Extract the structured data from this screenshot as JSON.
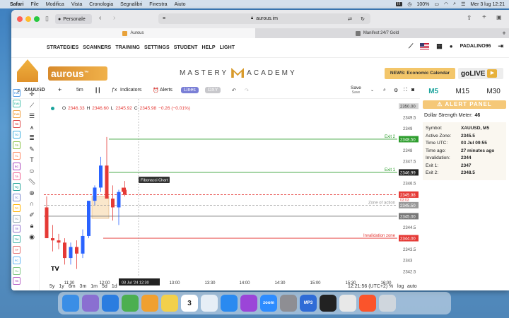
{
  "menubar": {
    "app": "Safari",
    "items": [
      "File",
      "Modifica",
      "Vista",
      "Cronologia",
      "Segnalibri",
      "Finestra",
      "Aiuto"
    ],
    "battery": "100%",
    "datetime": "Mer 3 lug 12:21",
    "lang": "IT"
  },
  "browser": {
    "profile": "Personale",
    "url": "aurous.im",
    "tabs": [
      {
        "label": "Aurous"
      },
      {
        "label": "Manifest 24/7 Gold"
      }
    ]
  },
  "site": {
    "nav": [
      "STRATEGIES",
      "SCANNERS",
      "TRAINING",
      "SETTINGS",
      "STUDENT",
      "HELP",
      "LIGHT"
    ],
    "user": "PADALINO96",
    "brand": "aurous",
    "brand_tm": "™",
    "academy_left": "MASTERY",
    "academy_right": "ACADEMY",
    "news_btn": "NEWS: Economic Calendar",
    "golive": "goLIVE"
  },
  "toolbar": {
    "symbol": "XAUUSD",
    "interval": "5m",
    "indicators": "Indicators",
    "alerts": "Alerts",
    "lines": "Lines",
    "dxy": "DXY",
    "save": "Save",
    "save_sub": "Save"
  },
  "ohlc": {
    "o_label": "O",
    "o": "2346.33",
    "h_label": "H",
    "h": "2346.60",
    "l_label": "L",
    "l": "2345.92",
    "c_label": "C",
    "c": "2345.98",
    "chg": "−0.26 (−0.01%)"
  },
  "chart_data": {
    "type": "candlestick",
    "symbol": "XAUUSD",
    "interval": "5m",
    "ylim": [
      2342.3,
      2350.2
    ],
    "y_ticks": [
      2350.0,
      2349.5,
      2349.0,
      2348.5,
      2348.0,
      2347.5,
      2347.0,
      2346.5,
      2346.0,
      2345.5,
      2345.0,
      2344.5,
      2344.0,
      2343.5,
      2343.0,
      2342.5
    ],
    "x_ticks": [
      "11:30",
      "12:00",
      "13:00",
      "13:30",
      "14:00",
      "14:30",
      "15:00",
      "15:30",
      "16:00"
    ],
    "crosshair_label": "03 Jul '24   12:30",
    "candles": [
      {
        "o": 2345.4,
        "h": 2345.9,
        "l": 2344.3,
        "c": 2344.0
      },
      {
        "o": 2344.0,
        "h": 2344.6,
        "l": 2343.4,
        "c": 2343.9
      },
      {
        "o": 2343.9,
        "h": 2344.2,
        "l": 2343.5,
        "c": 2343.8
      },
      {
        "o": 2343.8,
        "h": 2344.0,
        "l": 2342.8,
        "c": 2343.1
      },
      {
        "o": 2343.1,
        "h": 2343.8,
        "l": 2342.8,
        "c": 2343.6
      },
      {
        "o": 2343.6,
        "h": 2343.9,
        "l": 2342.6,
        "c": 2343.3
      },
      {
        "o": 2343.3,
        "h": 2344.4,
        "l": 2343.1,
        "c": 2344.1
      },
      {
        "o": 2344.1,
        "h": 2345.7,
        "l": 2344.0,
        "c": 2345.7
      },
      {
        "o": 2345.7,
        "h": 2346.4,
        "l": 2345.5,
        "c": 2346.3
      },
      {
        "o": 2346.3,
        "h": 2347.7,
        "l": 2346.1,
        "c": 2347.3
      },
      {
        "o": 2347.3,
        "h": 2348.6,
        "l": 2345.8,
        "c": 2345.8
      },
      {
        "o": 2345.8,
        "h": 2346.4,
        "l": 2344.8,
        "c": 2345.4
      },
      {
        "o": 2345.4,
        "h": 2346.2,
        "l": 2344.6,
        "c": 2346.1
      },
      {
        "o": 2346.2,
        "h": 2346.6,
        "l": 2345.9,
        "c": 2345.98
      }
    ],
    "levels": [
      {
        "name": "Exit 2",
        "value": 2348.5,
        "label": "2348.50",
        "color": "#2e9e2e"
      },
      {
        "name": "Exit 1",
        "value": 2346.99,
        "label": "2346.99",
        "color": "#2e9e2e"
      },
      {
        "name": "",
        "value": 2345.98,
        "label": "2345.98",
        "sub": "03:03",
        "color": "#e53935"
      },
      {
        "name": "Zone of action",
        "value": 2345.5,
        "label": "2345.50",
        "color": "#999999"
      },
      {
        "name": "",
        "value": 2345.0,
        "label": "2345.00",
        "color": "#777777"
      },
      {
        "name": "Invalidation zone",
        "value": 2344.0,
        "label": "2344.00",
        "color": "#e53935"
      }
    ],
    "price_top_label": "2350.00",
    "drawing_tooltip": "Fibonacci Chart"
  },
  "bottom": {
    "ranges": [
      "5y",
      "1y",
      "6m",
      "3m",
      "1m",
      "5d",
      "1d"
    ],
    "time": "12:21:56 (UTC+2)",
    "pct": "%",
    "log": "log",
    "auto": "auto"
  },
  "panel": {
    "tabs": [
      "M5",
      "M15",
      "M30"
    ],
    "alert_title": "ALERT PANEL",
    "strength_label": "Dollar Strength Meter:",
    "strength_value": "46",
    "rows": [
      [
        "Symbol:",
        "XAUUSD, M5"
      ],
      [
        "Active Zone:",
        "2345.5"
      ],
      [
        "Time UTC:",
        "03 Jul 09:55"
      ],
      [
        "Time ago:",
        "27 minutes ago"
      ],
      [
        "Invalidation:",
        "2344"
      ],
      [
        "Exit 1:",
        "2347"
      ],
      [
        "Exit 2:",
        "2348.5"
      ]
    ]
  },
  "left_tools": [
    "TM1",
    "TM2",
    "TM3",
    "TB",
    "TO",
    "TS",
    "TL",
    "SC",
    "TA",
    "TQ",
    "TC",
    "TC",
    "TC",
    "TE",
    "TM",
    "TF",
    "FC",
    "Tu",
    "TB"
  ],
  "dock": [
    {
      "name": "Finder",
      "color": "#3a8ee6"
    },
    {
      "name": "Launchpad",
      "color": "#8a6fd1"
    },
    {
      "name": "Safari",
      "color": "#2b7de0"
    },
    {
      "name": "Maps",
      "color": "#4caf50"
    },
    {
      "name": "Photos",
      "color": "#f0a030"
    },
    {
      "name": "Notes",
      "color": "#f2d04b"
    },
    {
      "name": "3",
      "color": "#ffffff"
    },
    {
      "name": "Freeform",
      "color": "#e6eef6"
    },
    {
      "name": "App Store",
      "color": "#2a8af0"
    },
    {
      "name": "Podcasts",
      "color": "#9b45d8"
    },
    {
      "name": "zoom",
      "color": "#2d8cff"
    },
    {
      "name": "Settings",
      "color": "#8e8e93"
    },
    {
      "name": "MP3",
      "color": "#2f6bd6"
    },
    {
      "name": "TV",
      "color": "#222222"
    },
    {
      "name": "Scanner",
      "color": "#e8e8e8"
    },
    {
      "name": "Brave",
      "color": "#fb542b"
    },
    {
      "name": "Trash",
      "color": "#cfd6dd"
    }
  ]
}
